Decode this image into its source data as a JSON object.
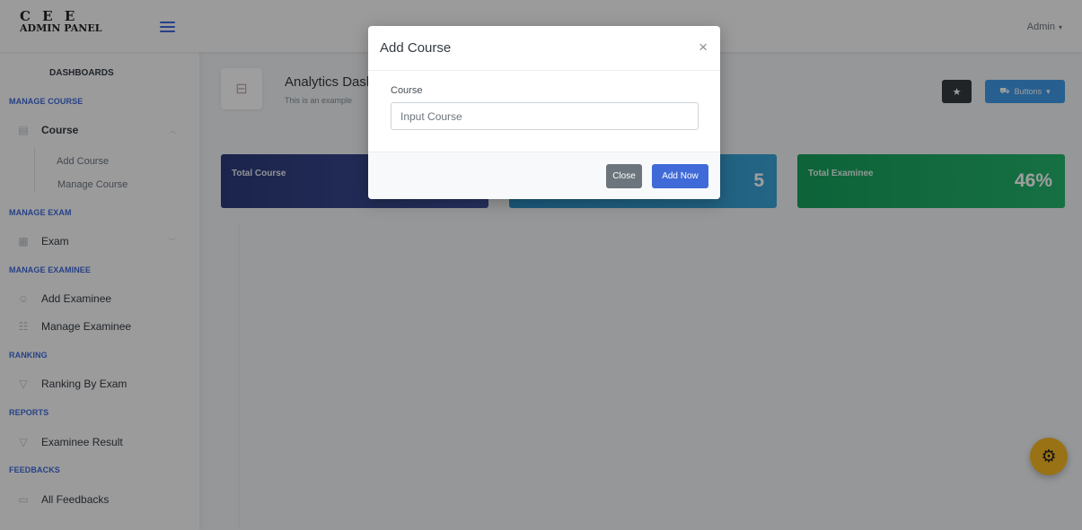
{
  "header": {
    "logo_line1": "C E E",
    "logo_line2": "ADMIN PANEL",
    "menu_icon": "hamburger-icon",
    "user_label": "Admin",
    "user_caret": "▾"
  },
  "sidebar": {
    "dashboards": "DASHBOARDS",
    "sections": {
      "manage_course": "MANAGE COURSE",
      "manage_exam": "MANAGE EXAM",
      "manage_examinee": "MANAGE EXAMINEE",
      "ranking": "RANKING",
      "reports": "REPORTS",
      "feedbacks": "FEEDBACKS"
    },
    "items": {
      "course": "Course",
      "add_course": "Add Course",
      "manage_course": "Manage Course",
      "exam": "Exam",
      "add_examinee": "Add Examinee",
      "manage_examinee": "Manage Examinee",
      "ranking_by_exam": "Ranking By Exam",
      "examinee_result": "Examinee Result",
      "all_feedbacks": "All Feedbacks"
    },
    "chevron": "︿",
    "chevron_down": "﹀"
  },
  "main": {
    "title": "Analytics Dasl",
    "subtitle": "This is an example",
    "star_icon": "★",
    "buttons_label": "Buttons",
    "buttons_caret": "▾",
    "cards": [
      {
        "title": "Total Course",
        "value": ""
      },
      {
        "title": "",
        "value": "5"
      },
      {
        "title": "Total Examinee",
        "value": "46%"
      }
    ]
  },
  "modal": {
    "title": "Add Course",
    "close_symbol": "×",
    "field_label": "Course",
    "field_placeholder": "Input Course",
    "field_value": "",
    "close_button": "Close",
    "add_button": "Add Now"
  },
  "colors": {
    "primary": "#3f6ad8",
    "card_1": "#2c3b7b",
    "card_2": "#2d8fc6",
    "card_3": "#17a05c",
    "gear": "#f7b924"
  }
}
